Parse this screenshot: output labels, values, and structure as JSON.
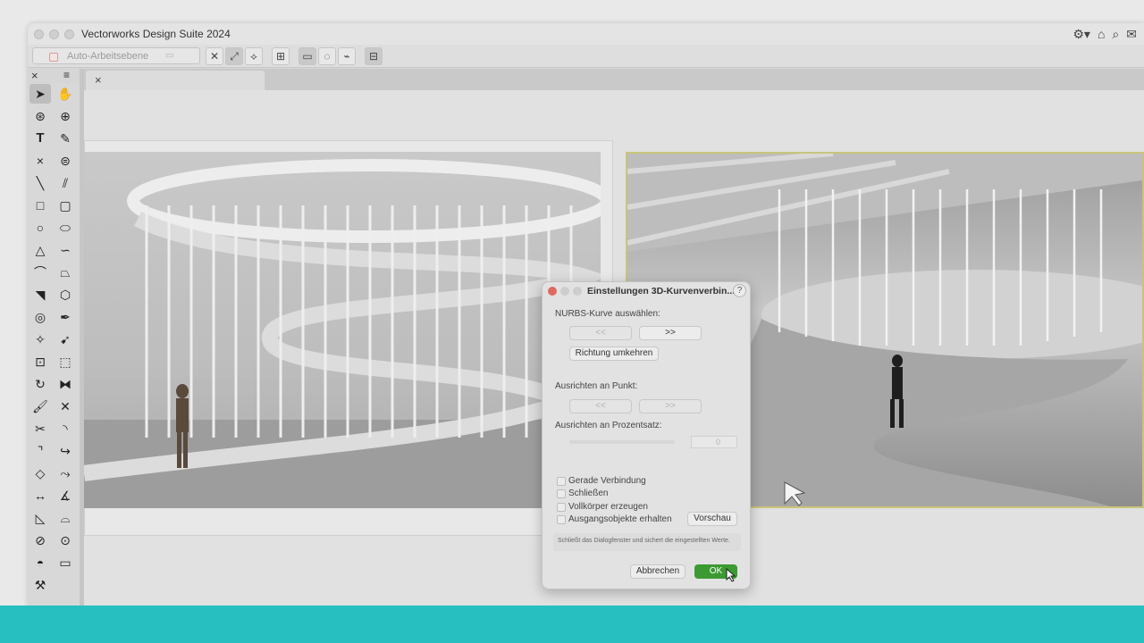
{
  "window": {
    "title": "Vectorworks Design Suite 2024"
  },
  "toolbar": {
    "plane_label": "Auto-Arbeitsebene"
  },
  "dialog": {
    "title": "Einstellungen 3D-Kurvenverbin...",
    "help": "?",
    "nurbs_label": "NURBS-Kurve auswählen:",
    "prev_label": "<<",
    "next_label": ">>",
    "reverse_label": "Richtung umkehren",
    "align_point_label": "Ausrichten an Punkt:",
    "align_percent_label": "Ausrichten an Prozentsatz:",
    "percent_value": "0",
    "checkboxes": [
      "Gerade Verbindung",
      "Schließen",
      "Vollkörper erzeugen",
      "Ausgangsobjekte erhalten"
    ],
    "preview_label": "Vorschau",
    "help_text": "Schließt das Dialogfenster und sichert die eingestellten Werte.",
    "cancel_label": "Abbrechen",
    "ok_label": "OK"
  },
  "colors": {
    "ok_button": "#3b9a32",
    "bottom_bar": "#27bfc0",
    "selection_border": "#c9c47a"
  }
}
